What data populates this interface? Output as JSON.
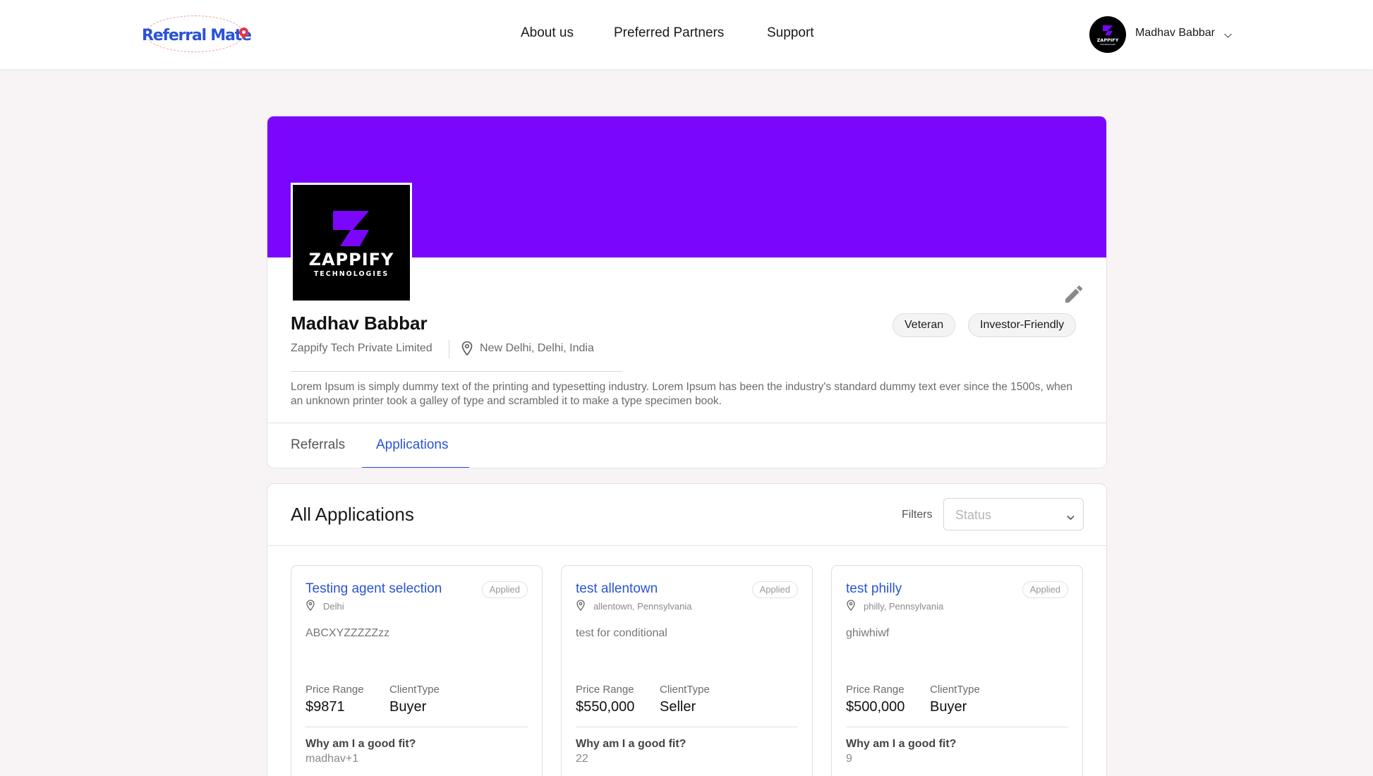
{
  "header": {
    "logo_text": "Referral Mate",
    "nav": [
      "About us",
      "Preferred Partners",
      "Support"
    ],
    "user_name": "Madhav Babbar"
  },
  "profile": {
    "company_logo_text": "ZAPPIFY",
    "company_logo_sub": "TECHNOLOGIES",
    "name": "Madhav Babbar",
    "company": "Zappify Tech Private Limited",
    "location": "New Delhi, Delhi, India",
    "badges": [
      "Veteran",
      "Investor-Friendly"
    ],
    "description": "Lorem Ipsum is simply dummy text of the printing and typesetting industry. Lorem Ipsum has been the industry's standard dummy text ever since the 1500s, when an unknown printer took a galley of type and scrambled it to make a type specimen book.",
    "tabs": [
      "Referrals",
      "Applications"
    ],
    "active_tab": "Applications",
    "banner_color": "#7a06fb",
    "accent_color": "#2a53d6"
  },
  "applications": {
    "title": "All Applications",
    "filters_label": "Filters",
    "status_placeholder": "Status",
    "price_label": "Price Range",
    "client_label": "ClientType",
    "why_label": "Why am I a good fit?",
    "items": [
      {
        "title": "Testing agent selection",
        "status": "Applied",
        "location": "Delhi",
        "description": "ABCXYZZZZZzz",
        "price": "$9871",
        "client_type": "Buyer",
        "why": "madhav+1"
      },
      {
        "title": "test allentown",
        "status": "Applied",
        "location": "allentown, Pennsylvania",
        "description": "test for conditional",
        "price": "$550,000",
        "client_type": "Seller",
        "why": "22"
      },
      {
        "title": "test philly",
        "status": "Applied",
        "location": "philly, Pennsylvania",
        "description": "ghiwhiwf",
        "price": "$500,000",
        "client_type": "Buyer",
        "why": "9"
      }
    ]
  }
}
